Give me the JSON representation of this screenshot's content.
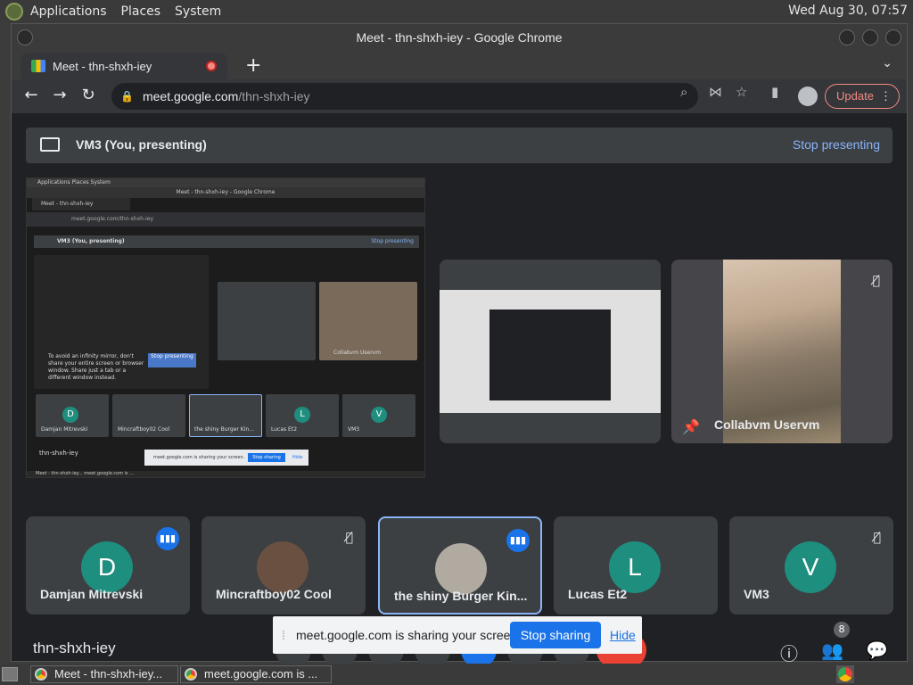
{
  "desktop": {
    "menu": [
      "Applications",
      "Places",
      "System"
    ],
    "clock": "Wed Aug 30, 07:57"
  },
  "window": {
    "title": "Meet - thn-shxh-iey - Google Chrome"
  },
  "tabs": [
    {
      "title": "Meet - thn-shxh-iey"
    }
  ],
  "toolbar": {
    "url_host": "meet.google.com",
    "url_path": "/thn-shxh-iey",
    "update_label": "Update"
  },
  "presenting": {
    "label": "VM3 (You, presenting)",
    "stop_label": "Stop presenting"
  },
  "preview": {
    "menu": "Applications   Places   System",
    "title": "Meet - thn-shxh-iey - Google Chrome",
    "tab": "Meet - thn-shxh-iey",
    "url": "meet.google.com/thn-shxh-iey",
    "bar_label": "VM3 (You, presenting)",
    "bar_stop": "Stop presenting",
    "mirror_msg": "To avoid an infinity mirror, don't share your entire screen or browser window. Share just a tab or a different window instead.",
    "mirror_stop": "Stop presenting",
    "cam_name": "Collabvm Uservm",
    "names": [
      "Damjan Mitrevski",
      "Mincraftboy02 Cool",
      "the shiny Burger Kin...",
      "Lucas Et2",
      "VM3"
    ],
    "code": "thn-shxh-iey",
    "toast": "meet.google.com is sharing your screen.",
    "toast_stop": "Stop sharing",
    "toast_hide": "Hide",
    "task": "Meet - thn-shxh-iey...   meet.google.com is ..."
  },
  "main_tiles": {
    "camera_name": "Collabvm Uservm"
  },
  "participants": [
    {
      "name": "Damjan Mitrevski",
      "initial": "D",
      "color": "#1e8e7e",
      "talking": true
    },
    {
      "name": "Mincraftboy02 Cool",
      "initial": "",
      "color": "#3c4043",
      "talking": false
    },
    {
      "name": "the shiny Burger Kin...",
      "initial": "",
      "color": "#7a7a7a",
      "talking": true
    },
    {
      "name": "Lucas Et2",
      "initial": "L",
      "color": "#1e8e7e",
      "talking": false
    },
    {
      "name": "VM3",
      "initial": "V",
      "color": "#1e8e7e",
      "talking": false
    }
  ],
  "bottom": {
    "meeting_code": "thn-shxh-iey",
    "people_count": "8"
  },
  "share_toast": {
    "message": "meet.google.com is sharing your screen.",
    "stop_label": "Stop sharing",
    "hide_label": "Hide"
  },
  "taskbar": {
    "items": [
      "Meet - thn-shxh-iey...",
      "meet.google.com is ..."
    ]
  }
}
